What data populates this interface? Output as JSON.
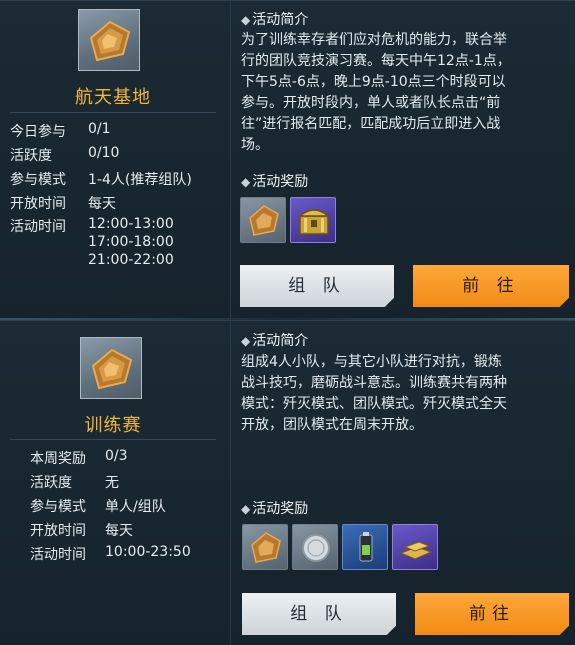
{
  "activities": [
    {
      "title": "航天基地",
      "info": [
        {
          "label": "今日参与",
          "value": "0/1"
        },
        {
          "label": "活跃度",
          "value": "0/10"
        },
        {
          "label": "参与模式",
          "value": "1-4人(推荐组队)"
        },
        {
          "label": "开放时间",
          "value": "每天"
        },
        {
          "label": "活动时间",
          "value": "12:00-13:00"
        }
      ],
      "extra_times": [
        "17:00-18:00",
        "21:00-22:00"
      ],
      "intro_label": "活动简介",
      "intro_lines": [
        "为了训练幸存者们应对危机的能力，联合举",
        "行的团队竞技演习赛。每天中午12点-1点，",
        "下午5点-6点，晚上9点-10点三个时段可以",
        "参与。开放时段内，单人或者队长点击“前",
        "往”进行报名匹配，匹配成功后立即进入战",
        "场。"
      ],
      "reward_label": "活动奖励",
      "rewards": [
        "badge-icon",
        "treasure-chest-icon"
      ],
      "team_button": "组 队",
      "go_button": "前 往"
    },
    {
      "title": "训练赛",
      "info": [
        {
          "label": "本周奖励",
          "value": "0/3"
        },
        {
          "label": "活跃度",
          "value": "无"
        },
        {
          "label": "参与模式",
          "value": "单人/组队"
        },
        {
          "label": "开放时间",
          "value": "每天"
        },
        {
          "label": "活动时间",
          "value": "10:00-23:50"
        }
      ],
      "intro_label": "活动简介",
      "intro_lines": [
        "组成4人小队，与其它小队进行对抗，锻炼",
        "战斗技巧，磨砺战斗意志。训练赛共有两种",
        "模式：歼灭模式、团队模式。歼灭模式全天",
        "开放，团队模式在周末开放。"
      ],
      "reward_label": "活动奖励",
      "rewards": [
        "badge-icon",
        "silver-coin-icon",
        "energy-drink-icon",
        "gold-bars-icon"
      ],
      "team_button": "组 队",
      "go_button": "前往"
    }
  ],
  "colors": {
    "title": "#f2b53a",
    "go_button": "#f08a15",
    "team_button": "#e1e6ea",
    "background": "#16232c"
  }
}
